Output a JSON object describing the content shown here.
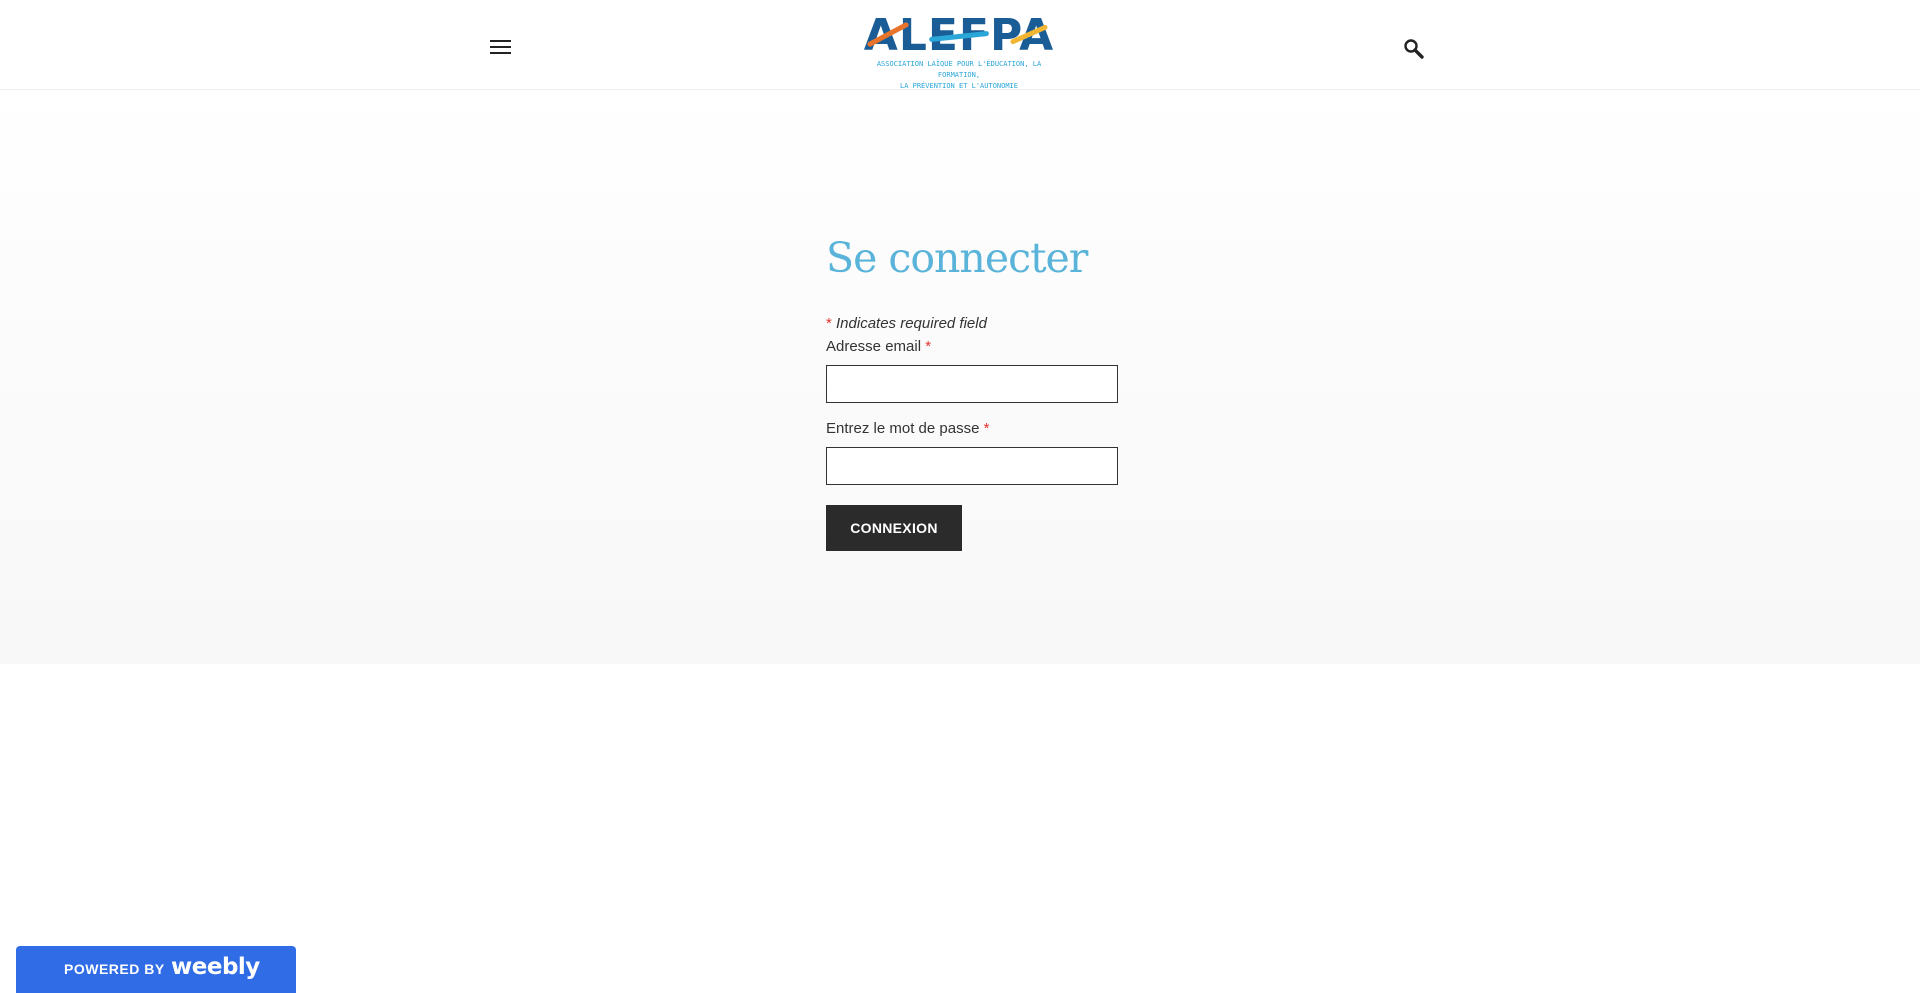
{
  "header": {
    "logo": {
      "wordmark": "ALEFPA",
      "tagline_line1": "ASSOCIATION LAÏQUE POUR L'ÉDUCATION, LA FORMATION,",
      "tagline_line2": "LA PRÉVENTION ET L'AUTONOMIE",
      "colors": {
        "navy": "#1a5d96",
        "orange": "#e8732a",
        "light_blue": "#2aa6d8",
        "yellow": "#f2b632"
      }
    },
    "menu_icon": "hamburger-icon",
    "search_icon": "search-icon"
  },
  "login": {
    "title": "Se connecter",
    "required_star": "*",
    "required_note": "Indicates required field",
    "email_label": "Adresse email",
    "email_value": "",
    "password_label": "Entrez le mot de passe",
    "password_value": "",
    "submit_label": "CONNEXION"
  },
  "footer_badge": {
    "powered_by": "POWERED BY",
    "brand": "weebly"
  },
  "colors": {
    "title": "#5ab3d9",
    "required": "#e0332e",
    "button_bg": "#2b2b2b",
    "badge_bg": "#2f6ce5"
  }
}
